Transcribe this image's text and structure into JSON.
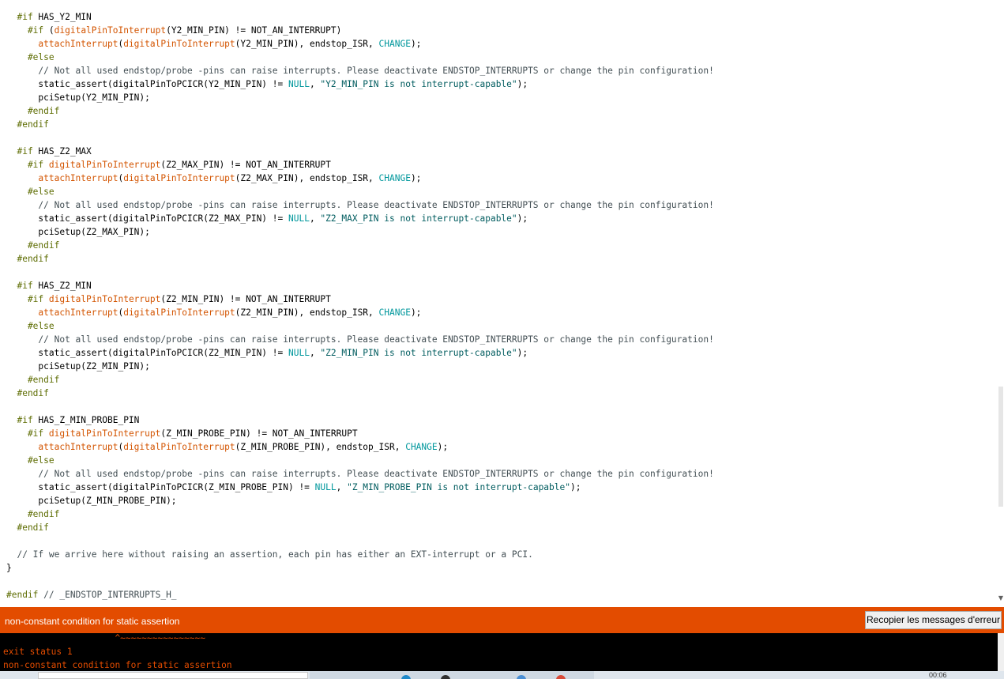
{
  "editor": {
    "lines": [
      [
        [
          "tok-kw",
          "  #if"
        ],
        [
          "tok-plain",
          " HAS_Y2_MIN"
        ]
      ],
      [
        [
          "tok-kw",
          "    #if"
        ],
        [
          "tok-plain",
          " ("
        ],
        [
          "tok-fn",
          "digitalPinToInterrupt"
        ],
        [
          "tok-plain",
          "(Y2_MIN_PIN) != NOT_AN_INTERRUPT)"
        ]
      ],
      [
        [
          "tok-fn",
          "      attachInterrupt"
        ],
        [
          "tok-plain",
          "("
        ],
        [
          "tok-fn",
          "digitalPinToInterrupt"
        ],
        [
          "tok-plain",
          "(Y2_MIN_PIN), endstop_ISR, "
        ],
        [
          "tok-const",
          "CHANGE"
        ],
        [
          "tok-plain",
          ");"
        ]
      ],
      [
        [
          "tok-kw",
          "    #else"
        ]
      ],
      [
        [
          "tok-cmt",
          "      // Not all used endstop/probe -pins can raise interrupts. Please deactivate ENDSTOP_INTERRUPTS or change the pin configuration!"
        ]
      ],
      [
        [
          "tok-plain",
          "      static_assert(digitalPinToPCICR(Y2_MIN_PIN) != "
        ],
        [
          "tok-const",
          "NULL"
        ],
        [
          "tok-plain",
          ", "
        ],
        [
          "tok-str",
          "\"Y2_MIN_PIN is not interrupt-capable\""
        ],
        [
          "tok-plain",
          ");"
        ]
      ],
      [
        [
          "tok-plain",
          "      pciSetup(Y2_MIN_PIN);"
        ]
      ],
      [
        [
          "tok-kw",
          "    #endif"
        ]
      ],
      [
        [
          "tok-kw",
          "  #endif"
        ]
      ],
      [],
      [
        [
          "tok-kw",
          "  #if"
        ],
        [
          "tok-plain",
          " HAS_Z2_MAX"
        ]
      ],
      [
        [
          "tok-kw",
          "    #if"
        ],
        [
          "tok-plain",
          " "
        ],
        [
          "tok-fn",
          "digitalPinToInterrupt"
        ],
        [
          "tok-plain",
          "(Z2_MAX_PIN) != NOT_AN_INTERRUPT"
        ]
      ],
      [
        [
          "tok-fn",
          "      attachInterrupt"
        ],
        [
          "tok-plain",
          "("
        ],
        [
          "tok-fn",
          "digitalPinToInterrupt"
        ],
        [
          "tok-plain",
          "(Z2_MAX_PIN), endstop_ISR, "
        ],
        [
          "tok-const",
          "CHANGE"
        ],
        [
          "tok-plain",
          ");"
        ]
      ],
      [
        [
          "tok-kw",
          "    #else"
        ]
      ],
      [
        [
          "tok-cmt",
          "      // Not all used endstop/probe -pins can raise interrupts. Please deactivate ENDSTOP_INTERRUPTS or change the pin configuration!"
        ]
      ],
      [
        [
          "tok-plain",
          "      static_assert(digitalPinToPCICR(Z2_MAX_PIN) != "
        ],
        [
          "tok-const",
          "NULL"
        ],
        [
          "tok-plain",
          ", "
        ],
        [
          "tok-str",
          "\"Z2_MAX_PIN is not interrupt-capable\""
        ],
        [
          "tok-plain",
          ");"
        ]
      ],
      [
        [
          "tok-plain",
          "      pciSetup(Z2_MAX_PIN);"
        ]
      ],
      [
        [
          "tok-kw",
          "    #endif"
        ]
      ],
      [
        [
          "tok-kw",
          "  #endif"
        ]
      ],
      [],
      [
        [
          "tok-kw",
          "  #if"
        ],
        [
          "tok-plain",
          " HAS_Z2_MIN"
        ]
      ],
      [
        [
          "tok-kw",
          "    #if"
        ],
        [
          "tok-plain",
          " "
        ],
        [
          "tok-fn",
          "digitalPinToInterrupt"
        ],
        [
          "tok-plain",
          "(Z2_MIN_PIN) != NOT_AN_INTERRUPT"
        ]
      ],
      [
        [
          "tok-fn",
          "      attachInterrupt"
        ],
        [
          "tok-plain",
          "("
        ],
        [
          "tok-fn",
          "digitalPinToInterrupt"
        ],
        [
          "tok-plain",
          "(Z2_MIN_PIN), endstop_ISR, "
        ],
        [
          "tok-const",
          "CHANGE"
        ],
        [
          "tok-plain",
          ");"
        ]
      ],
      [
        [
          "tok-kw",
          "    #else"
        ]
      ],
      [
        [
          "tok-cmt",
          "      // Not all used endstop/probe -pins can raise interrupts. Please deactivate ENDSTOP_INTERRUPTS or change the pin configuration!"
        ]
      ],
      [
        [
          "tok-plain",
          "      static_assert(digitalPinToPCICR(Z2_MIN_PIN) != "
        ],
        [
          "tok-const",
          "NULL"
        ],
        [
          "tok-plain",
          ", "
        ],
        [
          "tok-str",
          "\"Z2_MIN_PIN is not interrupt-capable\""
        ],
        [
          "tok-plain",
          ");"
        ]
      ],
      [
        [
          "tok-plain",
          "      pciSetup(Z2_MIN_PIN);"
        ]
      ],
      [
        [
          "tok-kw",
          "    #endif"
        ]
      ],
      [
        [
          "tok-kw",
          "  #endif"
        ]
      ],
      [],
      [
        [
          "tok-kw",
          "  #if"
        ],
        [
          "tok-plain",
          " HAS_Z_MIN_PROBE_PIN"
        ]
      ],
      [
        [
          "tok-kw",
          "    #if"
        ],
        [
          "tok-plain",
          " "
        ],
        [
          "tok-fn",
          "digitalPinToInterrupt"
        ],
        [
          "tok-plain",
          "(Z_MIN_PROBE_PIN) != NOT_AN_INTERRUPT"
        ]
      ],
      [
        [
          "tok-fn",
          "      attachInterrupt"
        ],
        [
          "tok-plain",
          "("
        ],
        [
          "tok-fn",
          "digitalPinToInterrupt"
        ],
        [
          "tok-plain",
          "(Z_MIN_PROBE_PIN), endstop_ISR, "
        ],
        [
          "tok-const",
          "CHANGE"
        ],
        [
          "tok-plain",
          ");"
        ]
      ],
      [
        [
          "tok-kw",
          "    #else"
        ]
      ],
      [
        [
          "tok-cmt",
          "      // Not all used endstop/probe -pins can raise interrupts. Please deactivate ENDSTOP_INTERRUPTS or change the pin configuration!"
        ]
      ],
      [
        [
          "tok-plain",
          "      static_assert(digitalPinToPCICR(Z_MIN_PROBE_PIN) != "
        ],
        [
          "tok-const",
          "NULL"
        ],
        [
          "tok-plain",
          ", "
        ],
        [
          "tok-str",
          "\"Z_MIN_PROBE_PIN is not interrupt-capable\""
        ],
        [
          "tok-plain",
          ");"
        ]
      ],
      [
        [
          "tok-plain",
          "      pciSetup(Z_MIN_PROBE_PIN);"
        ]
      ],
      [
        [
          "tok-kw",
          "    #endif"
        ]
      ],
      [
        [
          "tok-kw",
          "  #endif"
        ]
      ],
      [],
      [
        [
          "tok-cmt",
          "  // If we arrive here without raising an assertion, each pin has either an EXT-interrupt or a PCI."
        ]
      ],
      [
        [
          "tok-plain",
          "}"
        ]
      ],
      [],
      [
        [
          "tok-kw",
          "#endif"
        ],
        [
          "tok-cmt",
          " // _ENDSTOP_INTERRUPTS_H_"
        ]
      ]
    ],
    "scroll_fraction": 0.82
  },
  "status_bar": {
    "message": "non-constant condition for static assertion",
    "copy_button_label": "Recopier les messages d'erreur",
    "color": "#e34c00"
  },
  "console": {
    "lines": [
      "                     ^~~~~~~~~~~~~~~~~",
      "exit status 1",
      "non-constant condition for static assertion"
    ],
    "text_color": "#e34c00"
  },
  "taskbar": {
    "clock": "00:06",
    "icons": [
      "edge-icon",
      "explorer-icon",
      "store-icon",
      "chrome-icon"
    ]
  }
}
